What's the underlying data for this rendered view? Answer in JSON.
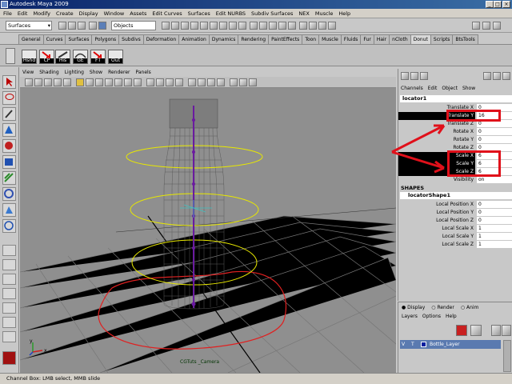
{
  "window": {
    "title": "Autodesk Maya 2009",
    "min": "_",
    "max": "□",
    "close": "×"
  },
  "menubar": [
    "File",
    "Edit",
    "Modify",
    "Create",
    "Display",
    "Window",
    "Assets",
    "Edit Curves",
    "Surfaces",
    "Edit NURBS",
    "Subdiv Surfaces",
    "NEX",
    "Muscle",
    "Help"
  ],
  "statusline": {
    "menuset": "Surfaces",
    "selection_mode": "Objects"
  },
  "shelf_tabs": [
    "General",
    "Curves",
    "Surfaces",
    "Polygons",
    "Subdivs",
    "Deformation",
    "Animation",
    "Dynamics",
    "Rendering",
    "PaintEffects",
    "Toon",
    "Muscle",
    "Fluids",
    "Fur",
    "Hair",
    "nCloth",
    "Donut",
    "Scripts",
    "BtsTools"
  ],
  "shelf_active_tab": "Donut",
  "shelf_buttons": [
    "Hshd",
    "CP",
    "His",
    "GE",
    "FT",
    "Out"
  ],
  "viewport": {
    "menu": [
      "View",
      "Shading",
      "Lighting",
      "Show",
      "Renderer",
      "Panels"
    ],
    "camera_label": "CGTuts _Camera",
    "axis_y": "y",
    "axis_x": "x"
  },
  "channelbox": {
    "tabs": [
      "Channels",
      "Edit",
      "Object",
      "Show"
    ],
    "node_name": "locator1",
    "attributes": [
      {
        "label": "Translate X",
        "value": "0"
      },
      {
        "label": "Translate Y",
        "value": "16"
      },
      {
        "label": "Translate Z",
        "value": "0"
      },
      {
        "label": "Rotate X",
        "value": "0"
      },
      {
        "label": "Rotate Y",
        "value": "0"
      },
      {
        "label": "Rotate Z",
        "value": "0"
      },
      {
        "label": "Scale X",
        "value": "6"
      },
      {
        "label": "Scale Y",
        "value": "6"
      },
      {
        "label": "Scale Z",
        "value": "6"
      },
      {
        "label": "Visibility",
        "value": "on"
      }
    ],
    "shapes_header": "SHAPES",
    "shape_name": "locatorShape1",
    "shape_attributes": [
      {
        "label": "Local Position X",
        "value": "0"
      },
      {
        "label": "Local Position Y",
        "value": "0"
      },
      {
        "label": "Local Position Z",
        "value": "0"
      },
      {
        "label": "Local Scale X",
        "value": "1"
      },
      {
        "label": "Local Scale Y",
        "value": "1"
      },
      {
        "label": "Local Scale Z",
        "value": "1"
      }
    ]
  },
  "layer_editor": {
    "modes": [
      "Display",
      "Render",
      "Anim"
    ],
    "menu": [
      "Layers",
      "Options",
      "Help"
    ],
    "layer": {
      "v": "V",
      "t": "T",
      "name": "Bottle_Layer"
    }
  },
  "helpline": "Channel Box: LMB select, MMB slide",
  "colors": {
    "annotation": "#e0101a",
    "selection": "#000000"
  }
}
